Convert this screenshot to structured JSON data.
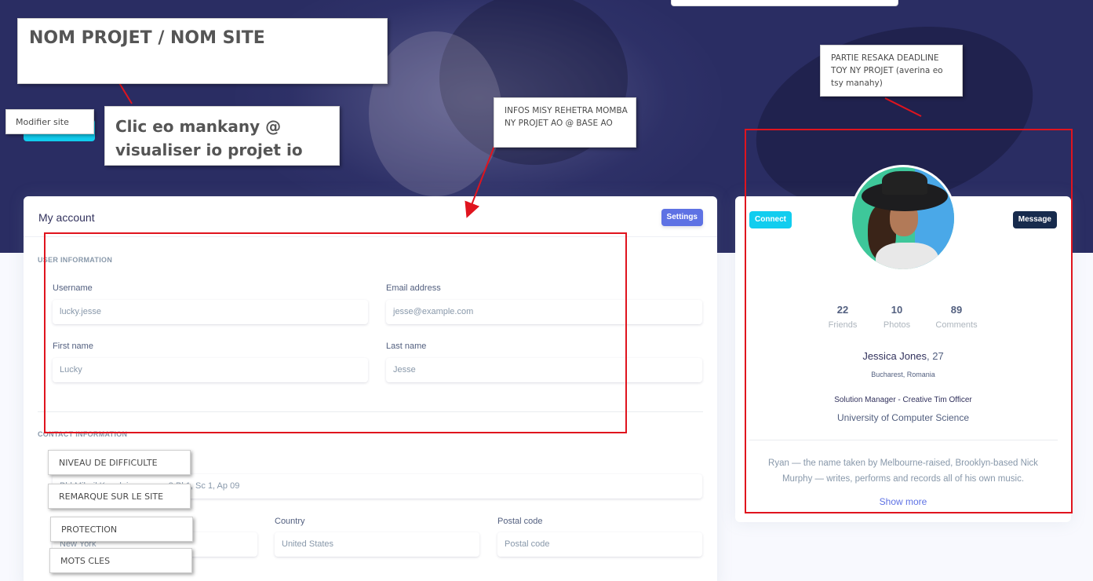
{
  "annotations": {
    "project_name": "NOM PROJET / NOM SITE",
    "modify_site": "Modifier site",
    "click_visualise": "Clic eo mankany @ visualiser io projet io",
    "project_info": "INFOS MISY REHETRA MOMBA NY PROJET AO @ BASE AO",
    "deadline_part": "PARTIE RESAKA DEADLINE TOY NY PROJET (averina eo tsy manahy)",
    "difficulty": "NIVEAU DE DIFFICULTE",
    "site_remark": "REMARQUE SUR LE SITE",
    "protection": "PROTECTION",
    "keywords": "MOTS CLES"
  },
  "account": {
    "title": "My account",
    "settings_label": "Settings",
    "user_section": "USER INFORMATION",
    "contact_section": "CONTACT INFORMATION",
    "username_label": "Username",
    "username_value": "lucky.jesse",
    "email_label": "Email address",
    "email_placeholder": "jesse@example.com",
    "firstname_label": "First name",
    "firstname_value": "Lucky",
    "lastname_label": "Last name",
    "lastname_value": "Jesse",
    "address_value": "Bld Mihail Kogalniceanu, nr. 8 Bl 1, Sc 1, Ap 09",
    "city_value": "New York",
    "country_label": "Country",
    "country_value": "United States",
    "postal_label": "Postal code",
    "postal_placeholder": "Postal code"
  },
  "profile": {
    "connect_label": "Connect",
    "message_label": "Message",
    "stats": [
      {
        "num": "22",
        "label": "Friends"
      },
      {
        "num": "10",
        "label": "Photos"
      },
      {
        "num": "89",
        "label": "Comments"
      }
    ],
    "name": "Jessica Jones",
    "age": ", 27",
    "location": "Bucharest, Romania",
    "job": "Solution Manager - Creative Tim Officer",
    "university": "University of Computer Science",
    "bio": "Ryan — the name taken by Melbourne-raised, Brooklyn-based Nick Murphy — writes, performs and records all of his own music.",
    "show_more": "Show more"
  },
  "colors": {
    "primary": "#5e72e4",
    "info": "#11cdef",
    "dark": "#172b4d",
    "hero": "#2a2d63",
    "annotation_red": "#e0141e"
  }
}
